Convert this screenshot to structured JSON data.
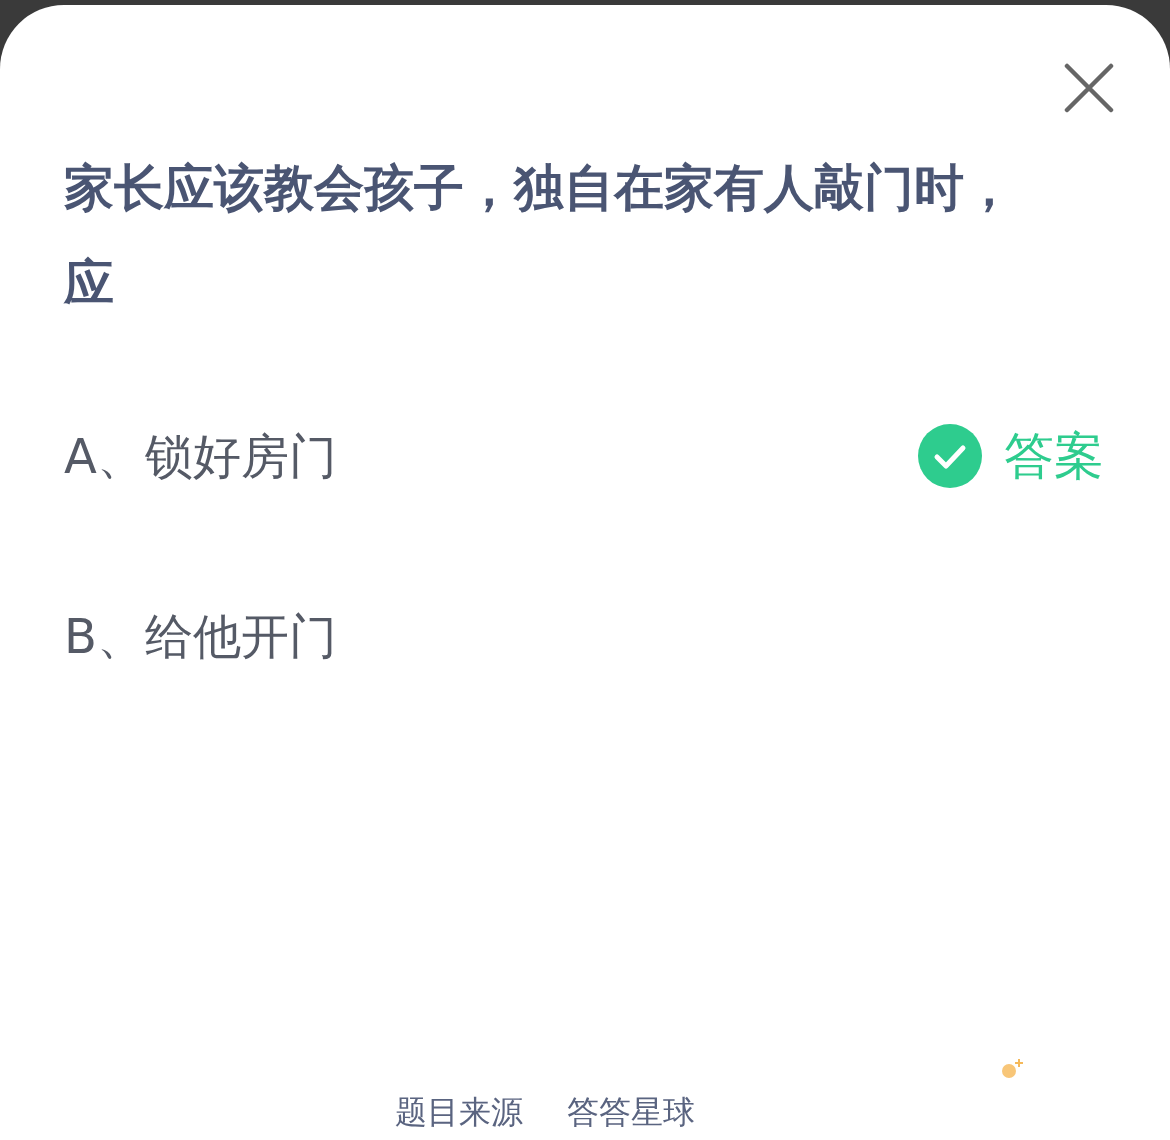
{
  "question": "家长应该教会孩子，独自在家有人敲门时，应",
  "options": [
    {
      "label": "A、锁好房门",
      "correct": true
    },
    {
      "label": "B、给他开门",
      "correct": false
    }
  ],
  "answer_label": "答案",
  "footer": {
    "source_label": "题目来源",
    "source_name": "答答星球"
  }
}
